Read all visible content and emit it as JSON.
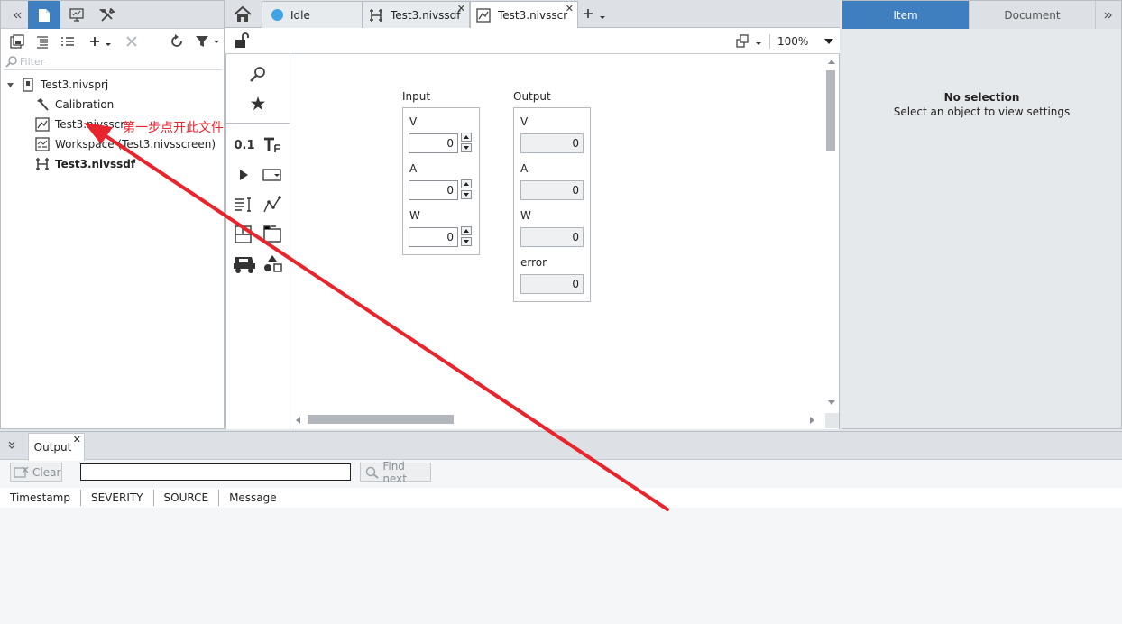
{
  "left_panel": {
    "filter_placeholder": "Filter",
    "tree": [
      {
        "label": "Test3.nivsprj"
      },
      {
        "label": "Calibration"
      },
      {
        "label": "Test3.nivsscr"
      },
      {
        "label": "Workspace (Test3.nivsscreen)"
      },
      {
        "label": "Test3.nivssdf"
      }
    ]
  },
  "doc_tabs": [
    {
      "label": "Idle"
    },
    {
      "label": "Test3.nivssdf"
    },
    {
      "label": "Test3.nivsscr"
    }
  ],
  "doc_toolbar": {
    "zoom": "100%"
  },
  "palette": {
    "numeric_label": "0.1"
  },
  "canvas": {
    "input": {
      "title": "Input",
      "controls": [
        {
          "label": "V",
          "value": "0"
        },
        {
          "label": "A",
          "value": "0"
        },
        {
          "label": "W",
          "value": "0"
        }
      ]
    },
    "output": {
      "title": "Output",
      "indicators": [
        {
          "label": "V",
          "value": "0"
        },
        {
          "label": "A",
          "value": "0"
        },
        {
          "label": "W",
          "value": "0"
        },
        {
          "label": "error",
          "value": "0"
        }
      ]
    }
  },
  "right_panel": {
    "tabs": [
      {
        "label": "Item"
      },
      {
        "label": "Document"
      }
    ],
    "empty_title": "No selection",
    "empty_text": "Select an object to view settings"
  },
  "bottom_panel": {
    "tab_label": "Output",
    "clear_label": "Clear",
    "find_next_label": "Find next",
    "search_value": "",
    "columns": [
      "Timestamp",
      "SEVERITY",
      "SOURCE",
      "Message"
    ]
  },
  "annotation": {
    "text": "第一步点开此文件",
    "color": "#e8242c"
  },
  "colors": {
    "accent": "#3f7fc0",
    "annotation_red": "#e8242c"
  }
}
